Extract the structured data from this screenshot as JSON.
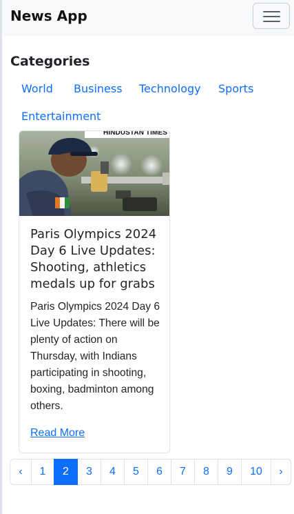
{
  "navbar": {
    "brand": "News App",
    "toggler_icon": "hamburger-icon"
  },
  "categories": {
    "heading": "Categories",
    "items": [
      "World",
      "Business",
      "Technology",
      "Sports",
      "Entertainment"
    ]
  },
  "article": {
    "image_source_label": "HINDUSTAN TIMES",
    "title": "Paris Olympics 2024 Day 6 Live Updates: Shooting, athletics medals up for grabs",
    "description": "Paris Olympics 2024 Day 6 Live Updates: There will be plenty of action on Thursday, with Indians participating in shooting, boxing, badminton among others.",
    "read_more": "Read More"
  },
  "pagination": {
    "prev": "‹",
    "next": "›",
    "pages": [
      "1",
      "2",
      "3",
      "4",
      "5",
      "6",
      "7",
      "8",
      "9",
      "10"
    ],
    "active_page": "2"
  },
  "colors": {
    "link": "#0d6efd",
    "navbar_bg": "#f8f9fa",
    "active_page_bg": "#0d6efd"
  }
}
